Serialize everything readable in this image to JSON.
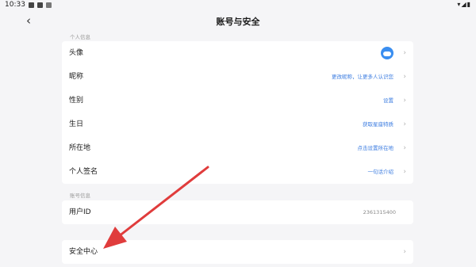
{
  "status_bar": {
    "time": "10:33",
    "right_icons": "▾◢▮"
  },
  "header": {
    "back_icon": "‹",
    "title": "账号与安全"
  },
  "personal_section": {
    "label": "个人信息",
    "rows": [
      {
        "label": "头像",
        "value": ""
      },
      {
        "label": "昵称",
        "value": "更改昵称，让更多人认识您"
      },
      {
        "label": "性别",
        "value": "设置"
      },
      {
        "label": "生日",
        "value": "获取星座特质"
      },
      {
        "label": "所在地",
        "value": "点击设置所在地"
      },
      {
        "label": "个人签名",
        "value": "一句话介绍"
      }
    ]
  },
  "account_section": {
    "label": "账号信息",
    "user_id_label": "用户ID",
    "user_id_value": "2361315400"
  },
  "security": {
    "label": "安全中心"
  },
  "chevron": "›",
  "colors": {
    "accent": "#3a7be0",
    "annotation_arrow": "#e03c3c",
    "background": "#f5f5f7"
  }
}
